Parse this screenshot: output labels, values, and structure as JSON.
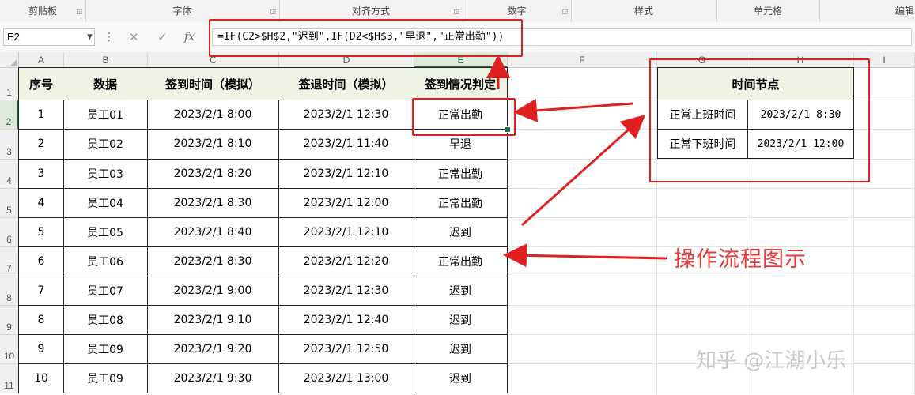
{
  "ribbon": {
    "groups": [
      "剪贴板",
      "字体",
      "对齐方式",
      "数字",
      "样式",
      "单元格",
      "编辑"
    ]
  },
  "formula_bar": {
    "name_box": "E2",
    "cancel_icon": "✕",
    "confirm_icon": "✓",
    "fx_label": "fx",
    "formula": "=IF(C2>$H$2,\"迟到\",IF(D2<$H$3,\"早退\",\"正常出勤\"))"
  },
  "sheet": {
    "columns": [
      "A",
      "B",
      "C",
      "D",
      "E",
      "F",
      "G",
      "H",
      "I"
    ],
    "rows": [
      "1",
      "2",
      "3",
      "4",
      "5",
      "6",
      "7",
      "8",
      "9",
      "10",
      "11"
    ],
    "active_column": "E",
    "active_row": "2"
  },
  "table": {
    "headers": [
      "序号",
      "数据",
      "签到时间（模拟）",
      "签退时间（模拟）",
      "签到情况判定"
    ],
    "rows": [
      [
        "1",
        "员工01",
        "2023/2/1 8:00",
        "2023/2/1 12:30",
        "正常出勤"
      ],
      [
        "2",
        "员工02",
        "2023/2/1 8:10",
        "2023/2/1 11:40",
        "早退"
      ],
      [
        "3",
        "员工03",
        "2023/2/1 8:20",
        "2023/2/1 12:10",
        "正常出勤"
      ],
      [
        "4",
        "员工04",
        "2023/2/1 8:30",
        "2023/2/1 12:00",
        "正常出勤"
      ],
      [
        "5",
        "员工05",
        "2023/2/1 8:40",
        "2023/2/1 12:10",
        "迟到"
      ],
      [
        "6",
        "员工06",
        "2023/2/1 8:30",
        "2023/2/1 12:20",
        "正常出勤"
      ],
      [
        "7",
        "员工07",
        "2023/2/1 9:00",
        "2023/2/1 12:30",
        "迟到"
      ],
      [
        "8",
        "员工08",
        "2023/2/1 9:10",
        "2023/2/1 12:40",
        "迟到"
      ],
      [
        "9",
        "员工09",
        "2023/2/1 9:20",
        "2023/2/1 12:50",
        "迟到"
      ],
      [
        "10",
        "员工09",
        "2023/2/1 9:30",
        "2023/2/1 13:00",
        "迟到"
      ]
    ]
  },
  "time_nodes": {
    "title": "时间节点",
    "rows": [
      [
        "正常上班时间",
        "2023/2/1 8:30"
      ],
      [
        "正常下班时间",
        "2023/2/1 12:00"
      ]
    ]
  },
  "annotation": "操作流程图示",
  "watermark": "知乎 @江湖小乐",
  "colors": {
    "accent": "#217346",
    "highlight": "#e02020",
    "header_fill": "#eef3e3"
  }
}
